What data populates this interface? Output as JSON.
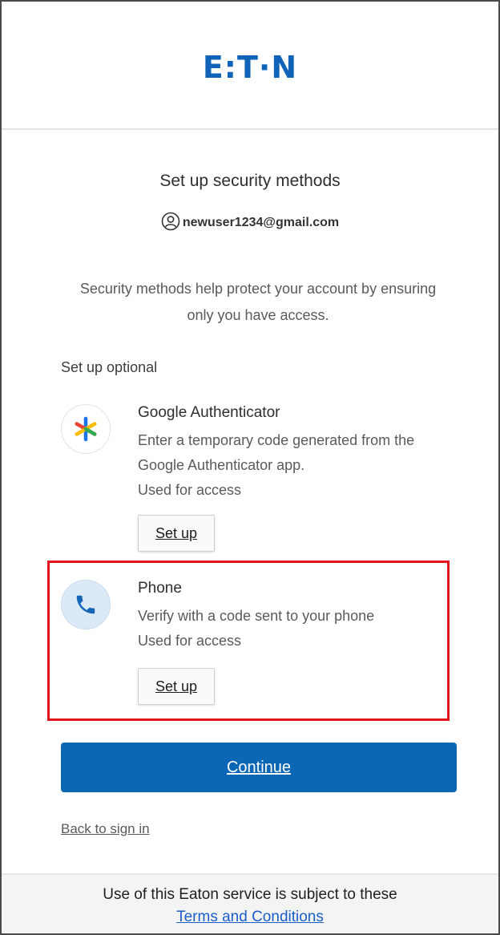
{
  "brand": {
    "logo_text": "E:T·N",
    "logo_color": "#0f63b8"
  },
  "page": {
    "title": "Set up security methods",
    "account_email": "newuser1234@gmail.com",
    "description": "Security methods help protect your account by ensuring only you have access.",
    "optional_label": "Set up optional"
  },
  "methods": [
    {
      "name": "Google Authenticator",
      "description": "Enter a temporary code generated from the Google Authenticator app.",
      "usage": "Used for access",
      "button_label": "Set up",
      "icon": "google-authenticator-icon"
    },
    {
      "name": "Phone",
      "description": "Verify with a code sent to your phone",
      "usage": "Used for access",
      "button_label": "Set up",
      "icon": "phone-icon"
    }
  ],
  "actions": {
    "continue_label": "Continue",
    "back_label": "Back to sign in"
  },
  "footer": {
    "text": "Use of this Eaton service is subject to these",
    "link_label": "Terms and Conditions"
  },
  "colors": {
    "primary": "#0b66b5",
    "highlight": "#e3141c",
    "link": "#1a5fc9"
  }
}
